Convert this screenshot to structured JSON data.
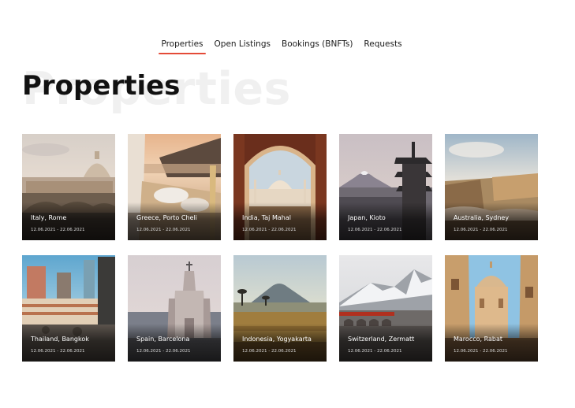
{
  "nav": {
    "tabs": [
      {
        "label": "Properties",
        "active": true
      },
      {
        "label": "Open Listings",
        "active": false
      },
      {
        "label": "Bookings (BNFTs)",
        "active": false
      },
      {
        "label": "Requests",
        "active": false
      }
    ],
    "accent_color": "#e44b38"
  },
  "page": {
    "title": "Properties",
    "ghost_title": "Properties"
  },
  "properties": [
    {
      "title": "Italy, Rome",
      "dates": "12.06.2021 - 22.06.2021"
    },
    {
      "title": "Greece, Porto Cheli",
      "dates": "12.06.2021 - 22.06.2021"
    },
    {
      "title": "India, Taj Mahal",
      "dates": "12.06.2021 - 22.06.2021"
    },
    {
      "title": "Japan, Kioto",
      "dates": "12.06.2021 - 22.06.2021"
    },
    {
      "title": "Australia, Sydney",
      "dates": "12.06.2021 - 22.06.2021"
    },
    {
      "title": "Thailand, Bangkok",
      "dates": "12.06.2021 - 22.06.2021"
    },
    {
      "title": "Spain, Barcelona",
      "dates": "12.06.2021 - 22.06.2021"
    },
    {
      "title": "Indonesia, Yogyakarta",
      "dates": "12.06.2021 - 22.06.2021"
    },
    {
      "title": "Switzerland, Zermatt",
      "dates": "12.06.2021 - 22.06.2021"
    },
    {
      "title": "Marocco, Rabat",
      "dates": "12.06.2021 - 22.06.2021"
    }
  ]
}
